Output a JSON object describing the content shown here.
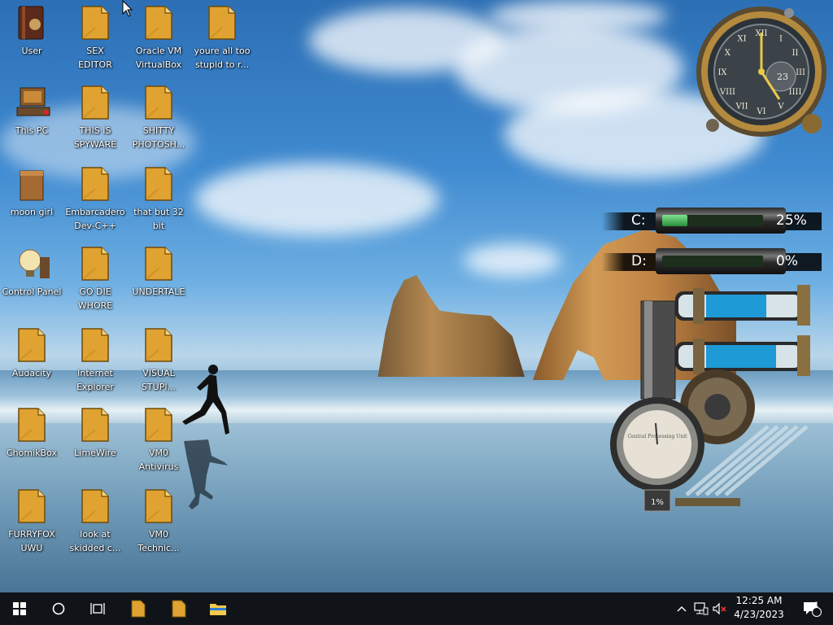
{
  "desktop": {
    "icons": [
      {
        "label": "User",
        "kind": "book"
      },
      {
        "label": "SEX\nEDITOR",
        "kind": "file"
      },
      {
        "label": "Oracle VM\nVirtualBox",
        "kind": "file"
      },
      {
        "label": "youre all too\nstupid to r...",
        "kind": "file"
      },
      {
        "label": "This PC",
        "kind": "computer"
      },
      {
        "label": "THIS IS\nSPYWARE",
        "kind": "file"
      },
      {
        "label": "SHITTY\nPHOTOSH...",
        "kind": "file"
      },
      {
        "label": "moon girl",
        "kind": "box"
      },
      {
        "label": "Embarcadero\nDev-C++",
        "kind": "file"
      },
      {
        "label": "that but 32\nbit",
        "kind": "file"
      },
      {
        "label": "Control Panel",
        "kind": "bulb"
      },
      {
        "label": "GO DIE\nWHORE",
        "kind": "file"
      },
      {
        "label": "UNDERTALE",
        "kind": "file"
      },
      {
        "label": "Audacity",
        "kind": "file"
      },
      {
        "label": "Internet\nExplorer",
        "kind": "file"
      },
      {
        "label": "VISUAL\nSTUPI...",
        "kind": "file"
      },
      {
        "label": "ChomikBox",
        "kind": "file"
      },
      {
        "label": "LimeWire",
        "kind": "file"
      },
      {
        "label": "VM0\nAntivirus",
        "kind": "file"
      },
      {
        "label": "FURRYFOX\nUWU",
        "kind": "file"
      },
      {
        "label": "look at\nskidded c...",
        "kind": "file"
      },
      {
        "label": "VM0\nTechnic...",
        "kind": "file"
      }
    ]
  },
  "gadgets": {
    "clock": {
      "hour_numerals": [
        "XII",
        "I",
        "II",
        "III",
        "IIII",
        "V",
        "VI",
        "VII",
        "VIII",
        "IX",
        "X",
        "XI"
      ],
      "date_number": "23"
    },
    "drives": [
      {
        "letter": "C:",
        "percent_text": "25%",
        "usage": 0.25
      },
      {
        "letter": "D:",
        "percent_text": "0%",
        "usage": 0.0
      }
    ],
    "cpu_gauge": {
      "percent_text": "1%",
      "dial_text": "Central Processing Unit"
    }
  },
  "taskbar": {
    "start_icon": "windows-logo-icon",
    "search_icon": "circle-search-icon",
    "taskview_icon": "task-view-icon",
    "pinned": [
      "file-icon",
      "file-icon",
      "folder-icon"
    ],
    "tray": {
      "time": "12:25 AM",
      "date": "4/23/2023",
      "notification_count": "1"
    }
  },
  "colors": {
    "taskbar_bg": "#101418",
    "file_icon": "#e0a230",
    "drive_fill": "#4fb85f",
    "pipe_liquid": "#1e9ad6"
  }
}
